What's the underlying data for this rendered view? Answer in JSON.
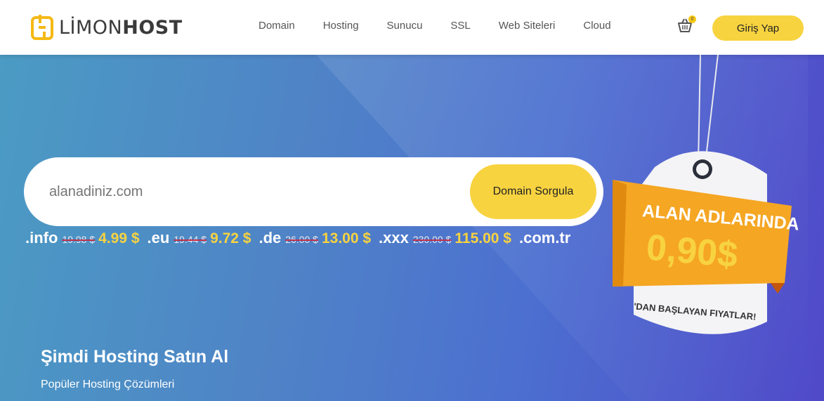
{
  "header": {
    "logo": {
      "part1": "LİMON",
      "part2": "HOST"
    },
    "nav": [
      "Domain",
      "Hosting",
      "Sunucu",
      "SSL",
      "Web Siteleri",
      "Cloud"
    ],
    "cart_count": "0",
    "login_label": "Giriş Yap"
  },
  "search": {
    "placeholder": "alanadiniz.com",
    "button_label": "Domain Sorgula"
  },
  "tlds": [
    {
      "name": ".info",
      "old_price": "19.98 $",
      "new_price": "4.99 $"
    },
    {
      "name": ".eu",
      "old_price": "19.44 $",
      "new_price": "9.72 $"
    },
    {
      "name": ".de",
      "old_price": "26.00 $",
      "new_price": "13.00 $"
    },
    {
      "name": ".xxx",
      "old_price": "230.00 $",
      "new_price": "115.00 $"
    },
    {
      "name": ".com.tr",
      "old_price": "",
      "new_price": ""
    }
  ],
  "promo_tag": {
    "line1": "ALAN ADLARINDA",
    "price": "0,90$",
    "line3": "'DAN BAŞLAYAN FIYATLAR!"
  },
  "hero": {
    "title": "Şimdi Hosting Satın Al",
    "subtitle": "Popüler Hosting Çözümleri"
  },
  "colors": {
    "accent": "#f8d340",
    "brand_orange": "#f5a623"
  },
  "icons": [
    "logo-mark-icon",
    "cart-icon"
  ]
}
